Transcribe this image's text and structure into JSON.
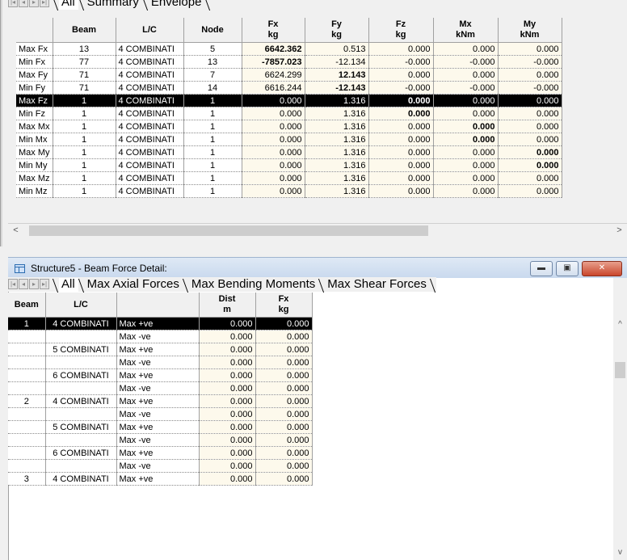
{
  "summary_window": {
    "tabs": [
      "All",
      "Summary",
      "Envelope"
    ],
    "columns": [
      {
        "line1": "",
        "line2": ""
      },
      {
        "line1": "Beam",
        "line2": ""
      },
      {
        "line1": "L/C",
        "line2": ""
      },
      {
        "line1": "Node",
        "line2": ""
      },
      {
        "line1": "Fx",
        "line2": "kg"
      },
      {
        "line1": "Fy",
        "line2": "kg"
      },
      {
        "line1": "Fz",
        "line2": "kg"
      },
      {
        "line1": "Mx",
        "line2": "kNm"
      },
      {
        "line1": "My",
        "line2": "kNm"
      }
    ],
    "rows": [
      {
        "label": "Max Fx",
        "beam": "13",
        "lc": "4 COMBINATI",
        "node": "5",
        "fx": "6642.362",
        "fy": "0.513",
        "fz": "0.000",
        "mx": "0.000",
        "my": "0.000"
      },
      {
        "label": "Min Fx",
        "beam": "77",
        "lc": "4 COMBINATI",
        "node": "13",
        "fx": "-7857.023",
        "fy": "-12.134",
        "fz": "-0.000",
        "mx": "-0.000",
        "my": "-0.000"
      },
      {
        "label": "Max Fy",
        "beam": "71",
        "lc": "4 COMBINATI",
        "node": "7",
        "fx": "6624.299",
        "fy": "12.143",
        "fz": "0.000",
        "mx": "0.000",
        "my": "0.000"
      },
      {
        "label": "Min Fy",
        "beam": "71",
        "lc": "4 COMBINATI",
        "node": "14",
        "fx": "6616.244",
        "fy": "-12.143",
        "fz": "-0.000",
        "mx": "-0.000",
        "my": "-0.000"
      },
      {
        "label": "Max Fz",
        "beam": "1",
        "lc": "4 COMBINATI",
        "node": "1",
        "fx": "0.000",
        "fy": "1.316",
        "fz": "0.000",
        "mx": "0.000",
        "my": "0.000"
      },
      {
        "label": "Min Fz",
        "beam": "1",
        "lc": "4 COMBINATI",
        "node": "1",
        "fx": "0.000",
        "fy": "1.316",
        "fz": "0.000",
        "mx": "0.000",
        "my": "0.000"
      },
      {
        "label": "Max Mx",
        "beam": "1",
        "lc": "4 COMBINATI",
        "node": "1",
        "fx": "0.000",
        "fy": "1.316",
        "fz": "0.000",
        "mx": "0.000",
        "my": "0.000"
      },
      {
        "label": "Min Mx",
        "beam": "1",
        "lc": "4 COMBINATI",
        "node": "1",
        "fx": "0.000",
        "fy": "1.316",
        "fz": "0.000",
        "mx": "0.000",
        "my": "0.000"
      },
      {
        "label": "Max My",
        "beam": "1",
        "lc": "4 COMBINATI",
        "node": "1",
        "fx": "0.000",
        "fy": "1.316",
        "fz": "0.000",
        "mx": "0.000",
        "my": "0.000"
      },
      {
        "label": "Min My",
        "beam": "1",
        "lc": "4 COMBINATI",
        "node": "1",
        "fx": "0.000",
        "fy": "1.316",
        "fz": "0.000",
        "mx": "0.000",
        "my": "0.000"
      },
      {
        "label": "Max Mz",
        "beam": "1",
        "lc": "4 COMBINATI",
        "node": "1",
        "fx": "0.000",
        "fy": "1.316",
        "fz": "0.000",
        "mx": "0.000",
        "my": "0.000"
      },
      {
        "label": "Min Mz",
        "beam": "1",
        "lc": "4 COMBINATI",
        "node": "1",
        "fx": "0.000",
        "fy": "1.316",
        "fz": "0.000",
        "mx": "0.000",
        "my": "0.000"
      }
    ],
    "selected_row": 4,
    "bold_cells": [
      [
        0,
        "fx"
      ],
      [
        1,
        "fx"
      ],
      [
        2,
        "fy"
      ],
      [
        3,
        "fy"
      ],
      [
        4,
        "fz"
      ],
      [
        5,
        "fz"
      ],
      [
        6,
        "mx"
      ],
      [
        7,
        "mx"
      ],
      [
        8,
        "my"
      ],
      [
        9,
        "my"
      ]
    ],
    "scroll_left_icon": "chevron-left-icon",
    "scroll_right_icon": "chevron-right-icon"
  },
  "detail_window": {
    "title": "Structure5 - Beam Force Detail:",
    "tabs": [
      "All",
      "Max Axial Forces",
      "Max Bending Moments",
      "Max Shear Forces"
    ],
    "window_buttons": {
      "minimize": "minimize-icon",
      "maximize": "maximize-icon",
      "close": "close-icon"
    },
    "columns": [
      {
        "line1": "Beam",
        "line2": ""
      },
      {
        "line1": "L/C",
        "line2": ""
      },
      {
        "line1": "",
        "line2": ""
      },
      {
        "line1": "Dist",
        "line2": "m"
      },
      {
        "line1": "Fx",
        "line2": "kg"
      }
    ],
    "rows": [
      {
        "beam": "1",
        "lc": "4 COMBINATI",
        "type": "Max +ve",
        "dist": "0.000",
        "fx": "0.000"
      },
      {
        "beam": "",
        "lc": "",
        "type": "Max -ve",
        "dist": "0.000",
        "fx": "0.000"
      },
      {
        "beam": "",
        "lc": "5 COMBINATI",
        "type": "Max +ve",
        "dist": "0.000",
        "fx": "0.000"
      },
      {
        "beam": "",
        "lc": "",
        "type": "Max -ve",
        "dist": "0.000",
        "fx": "0.000"
      },
      {
        "beam": "",
        "lc": "6 COMBINATI",
        "type": "Max +ve",
        "dist": "0.000",
        "fx": "0.000"
      },
      {
        "beam": "",
        "lc": "",
        "type": "Max -ve",
        "dist": "0.000",
        "fx": "0.000"
      },
      {
        "beam": "2",
        "lc": "4 COMBINATI",
        "type": "Max +ve",
        "dist": "0.000",
        "fx": "0.000"
      },
      {
        "beam": "",
        "lc": "",
        "type": "Max -ve",
        "dist": "0.000",
        "fx": "0.000"
      },
      {
        "beam": "",
        "lc": "5 COMBINATI",
        "type": "Max +ve",
        "dist": "0.000",
        "fx": "0.000"
      },
      {
        "beam": "",
        "lc": "",
        "type": "Max -ve",
        "dist": "0.000",
        "fx": "0.000"
      },
      {
        "beam": "",
        "lc": "6 COMBINATI",
        "type": "Max +ve",
        "dist": "0.000",
        "fx": "0.000"
      },
      {
        "beam": "",
        "lc": "",
        "type": "Max -ve",
        "dist": "0.000",
        "fx": "0.000"
      },
      {
        "beam": "3",
        "lc": "4 COMBINATI",
        "type": "Max +ve",
        "dist": "0.000",
        "fx": "0.000"
      }
    ],
    "selected_row": 0
  }
}
